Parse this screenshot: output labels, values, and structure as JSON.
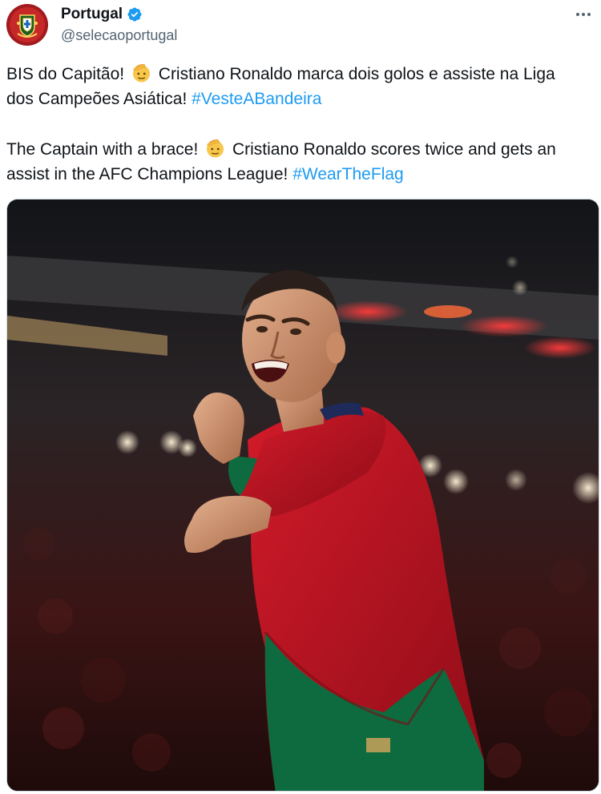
{
  "account": {
    "display_name": "Portugal",
    "handle": "@selecaoportugal",
    "verified": true,
    "avatar_icon": "portugal-federation-crest"
  },
  "tweet": {
    "para1": {
      "before_emoji": "BIS do Capitão! ",
      "after_emoji": " Cristiano Ronaldo marca dois golos e assiste na Liga",
      "line2": "dos Campeões Asiática! ",
      "hashtag": "#VesteABandeira"
    },
    "para2": {
      "before_emoji": "The Captain with a brace! ",
      "after_emoji": " Cristiano Ronaldo scores twice and gets an",
      "line2": "assist in the AFC Champions League! ",
      "hashtag": "#WearTheFlag"
    },
    "emoji_icon": "saluting-face-emoji"
  },
  "media": {
    "image_subject": "player-celebrating-photo"
  },
  "colors": {
    "hashtag": "#1d9bf0",
    "secondary_text": "#536471",
    "verified_badge": "#1d9bf0",
    "jersey_red": "#c8102e",
    "jersey_green": "#006847"
  }
}
